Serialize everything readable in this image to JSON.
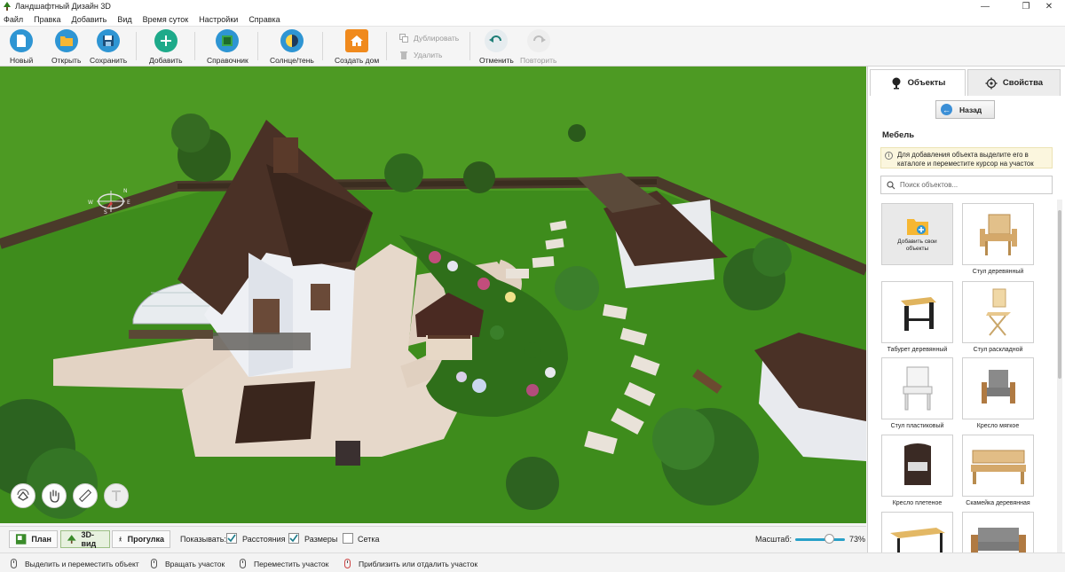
{
  "window": {
    "title": "Ландшафтный Дизайн 3D",
    "controls": [
      "—",
      "❐",
      "✕"
    ]
  },
  "menu": [
    "Файл",
    "Правка",
    "Добавить",
    "Вид",
    "Время суток",
    "Настройки",
    "Справка"
  ],
  "toolbar": {
    "new": "Новый",
    "open": "Открыть",
    "save": "Сохранить",
    "add": "Добавить",
    "reference": "Справочник",
    "sun_shadow": "Солнце/тень",
    "create_house": "Создать дом",
    "duplicate": "Дублировать",
    "delete": "Удалить",
    "undo": "Отменить",
    "redo": "Повторить"
  },
  "viewport": {
    "compass_letters": [
      "N",
      "S",
      "E",
      "W"
    ]
  },
  "view_tabs": {
    "plan": "План",
    "view3d": "3D-вид",
    "walk": "Прогулка",
    "active": "3D-вид"
  },
  "display": {
    "label": "Показывать:",
    "options": [
      {
        "label": "Расстояния",
        "checked": true
      },
      {
        "label": "Размеры",
        "checked": true
      },
      {
        "label": "Сетка",
        "checked": false
      }
    ]
  },
  "scale": {
    "label": "Масштаб:",
    "value_text": "73%",
    "value": 0.73
  },
  "status": [
    "Выделить и переместить объект",
    "Вращать участок",
    "Переместить участок",
    "Приблизить или отдалить участок"
  ],
  "panel": {
    "tab_objects": "Объекты",
    "tab_properties": "Свойства",
    "back": "Назад",
    "category": "Мебель",
    "hint": "Для добавления объекта выделите его в каталоге и переместите курсор на участок",
    "search_placeholder": "Поиск объектов...",
    "add_own": "Добавить свои объекты",
    "items": [
      "Стул деревянный",
      "Табурет деревянный",
      "Стул раскладной",
      "Стул пластиковый",
      "Кресло мягкое",
      "Кресло плетеное",
      "Скамейка деревянная"
    ]
  },
  "colors": {
    "accent": "#2e95d3",
    "grass": "#3f8a1e",
    "roof": "#4a3126",
    "paving": "#e3d3c4"
  }
}
